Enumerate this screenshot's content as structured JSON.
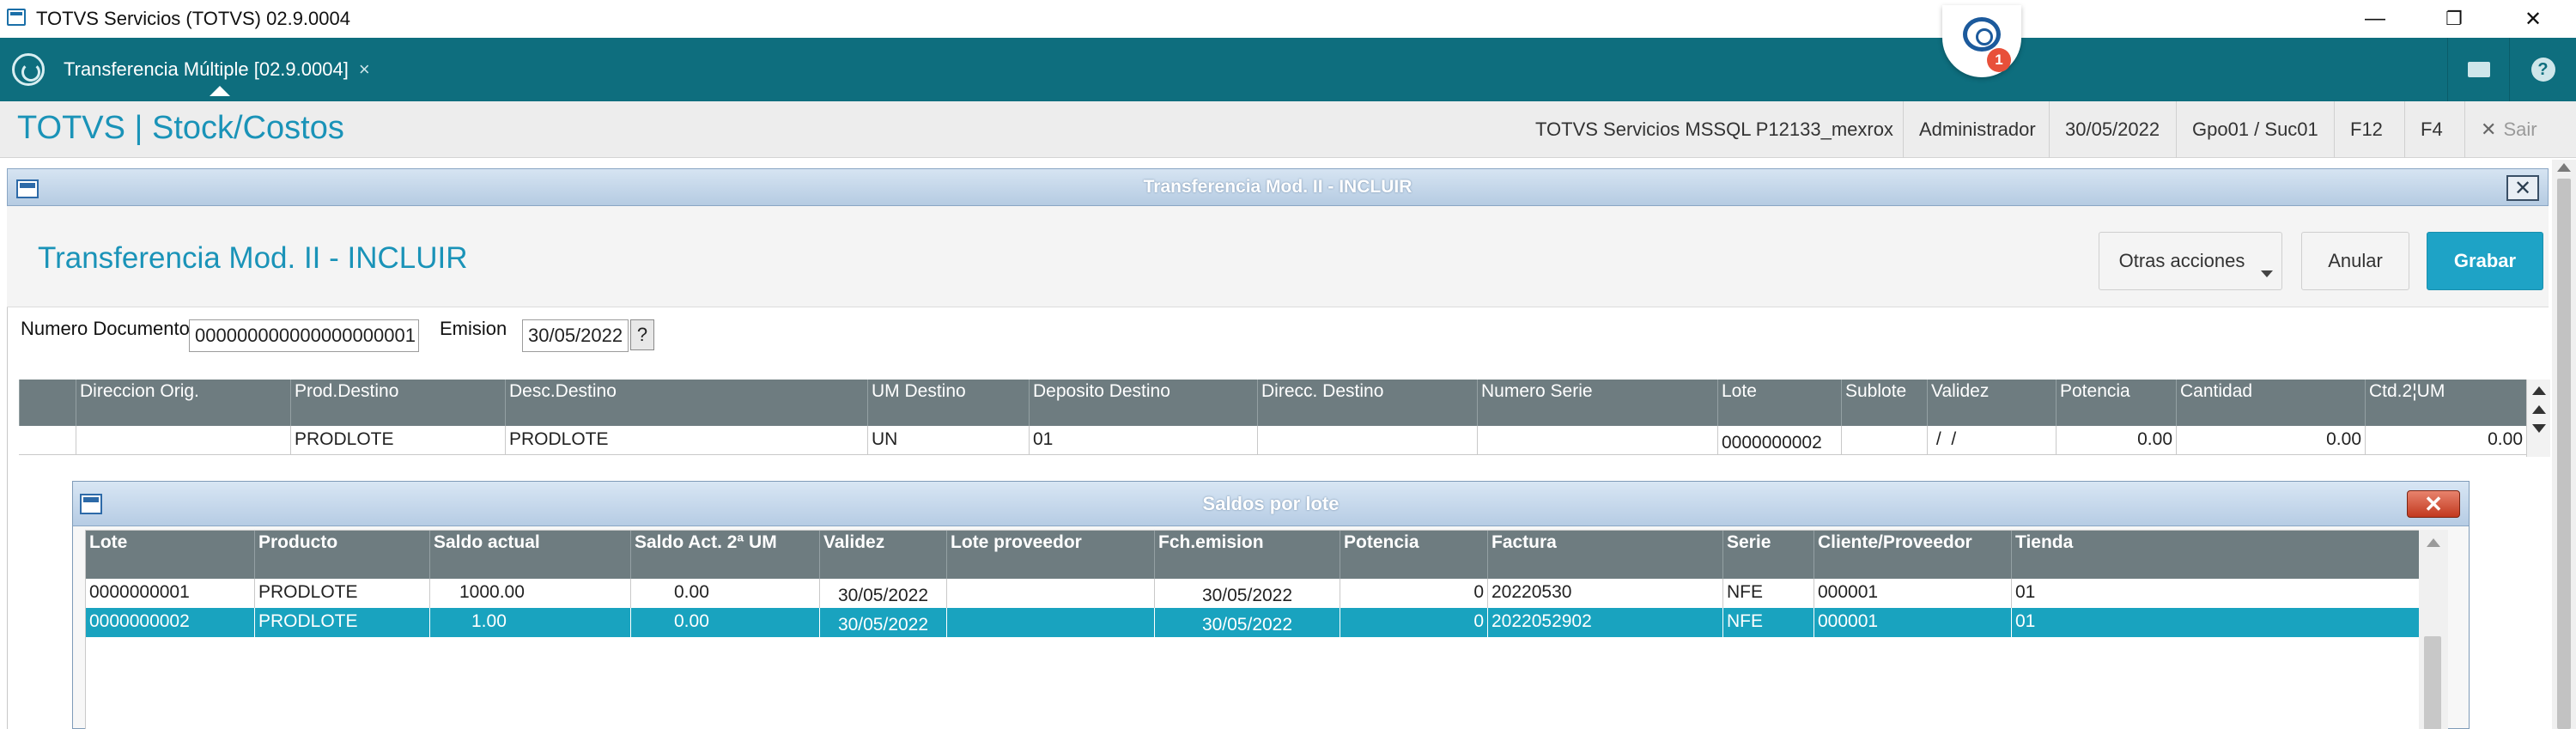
{
  "os_window": {
    "title": "TOTVS Servicios (TOTVS) 02.9.0004",
    "minimize": "—",
    "restore": "❐",
    "close": "✕"
  },
  "tabbar": {
    "active_tab": "Transferencia Múltiple [02.9.0004]",
    "tab_close": "×",
    "assistant_badge": "1",
    "help_glyph": "?"
  },
  "module": {
    "title": "TOTVS | Stock/Costos",
    "environment": "TOTVS Servicios MSSQL P12133_mexrox",
    "user": "Administrador",
    "date": "30/05/2022",
    "branch": "Gpo01 / Suc01",
    "key_f12": "F12",
    "key_f4": "F4",
    "exit_glyph": "✕",
    "exit_label": "Sair"
  },
  "dialog": {
    "title": "Transferencia Mod. II - INCLUIR",
    "close_glyph": "✕",
    "form_title": "Transferencia Mod. II - INCLUIR",
    "actions": {
      "other": "Otras acciones",
      "cancel": "Anular",
      "save": "Grabar"
    },
    "fields": {
      "doc_label": "Numero Documento",
      "doc_value": "000000000000000000001",
      "emission_label": "Emision",
      "emission_value": "30/05/2022",
      "help_glyph": "?"
    }
  },
  "grid1": {
    "columns": [
      "Direccion Orig.",
      "Prod.Destino",
      "Desc.Destino",
      "UM Destino",
      "Deposito Destino",
      "Direcc. Destino",
      "Numero Serie",
      "Lote",
      "Sublote",
      "Validez",
      "Potencia",
      "Cantidad",
      "Ctd.2¦UM"
    ],
    "row": [
      "",
      "PRODLOTE",
      "PRODLOTE",
      "UN",
      "01",
      "",
      "",
      "0000000002",
      "",
      " /  /",
      "0.00",
      "0.00",
      "0.00"
    ]
  },
  "lot_dialog": {
    "title": "Saldos por lote",
    "close_glyph": "✕",
    "columns": [
      "Lote",
      "Producto",
      "Saldo actual",
      "Saldo Act. 2ª UM",
      "Validez",
      "Lote proveedor",
      "Fch.emision",
      "Potencia",
      "Factura",
      "Serie",
      "Cliente/Proveedor",
      "Tienda"
    ],
    "rows": [
      [
        "0000000001",
        "PRODLOTE",
        "1000.00",
        "0.00",
        "30/05/2022",
        "",
        "30/05/2022",
        "0",
        "20220530",
        "NFE",
        "000001",
        "01"
      ],
      [
        "0000000002",
        "PRODLOTE",
        "1.00",
        "0.00",
        "30/05/2022",
        "",
        "30/05/2022",
        "0",
        "2022052902",
        "NFE",
        "000001",
        "01"
      ]
    ],
    "selected_row_index": 1
  },
  "colors": {
    "tab_bar": "#0e6e7e",
    "accent": "#1a93b8",
    "primary_button": "#1ea3c6",
    "grid_header": "#6e7c80",
    "selected_row": "#19a3bf",
    "close_red": "#c2391f"
  }
}
